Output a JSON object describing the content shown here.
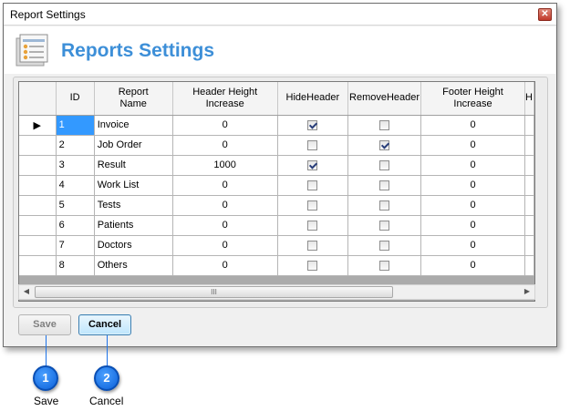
{
  "window": {
    "title": "Report Settings"
  },
  "header": {
    "title": "Reports Settings",
    "icon": "report-settings-icon"
  },
  "grid": {
    "columns": [
      "ID",
      "Report\nName",
      "Header Height\nIncrease",
      "HideHeader",
      "RemoveHeader",
      "Footer Height\nIncrease",
      "H"
    ],
    "rows": [
      {
        "id": "1",
        "name": "Invoice",
        "header_height": "0",
        "hide_header": true,
        "remove_header": false,
        "footer_height": "0",
        "selected": true
      },
      {
        "id": "2",
        "name": "Job Order",
        "header_height": "0",
        "hide_header": false,
        "remove_header": true,
        "footer_height": "0",
        "selected": false
      },
      {
        "id": "3",
        "name": "Result",
        "header_height": "1000",
        "hide_header": true,
        "remove_header": false,
        "footer_height": "0",
        "selected": false
      },
      {
        "id": "4",
        "name": "Work List",
        "header_height": "0",
        "hide_header": false,
        "remove_header": false,
        "footer_height": "0",
        "selected": false
      },
      {
        "id": "5",
        "name": "Tests",
        "header_height": "0",
        "hide_header": false,
        "remove_header": false,
        "footer_height": "0",
        "selected": false
      },
      {
        "id": "6",
        "name": "Patients",
        "header_height": "0",
        "hide_header": false,
        "remove_header": false,
        "footer_height": "0",
        "selected": false
      },
      {
        "id": "7",
        "name": "Doctors",
        "header_height": "0",
        "hide_header": false,
        "remove_header": false,
        "footer_height": "0",
        "selected": false
      },
      {
        "id": "8",
        "name": "Others",
        "header_height": "0",
        "hide_header": false,
        "remove_header": false,
        "footer_height": "0",
        "selected": false
      }
    ],
    "current_row_marker": "▶",
    "scroll_thumb_grip": "III"
  },
  "buttons": {
    "save_label": "Save",
    "cancel_label": "Cancel"
  },
  "callouts": [
    {
      "number": "1",
      "label": "Save"
    },
    {
      "number": "2",
      "label": "Cancel"
    }
  ],
  "colors": {
    "title_blue": "#3d8fd8",
    "selected_cell": "#3399ff",
    "highlight_cell": "#fde4e4",
    "callout_blue": "#1e73e8"
  }
}
